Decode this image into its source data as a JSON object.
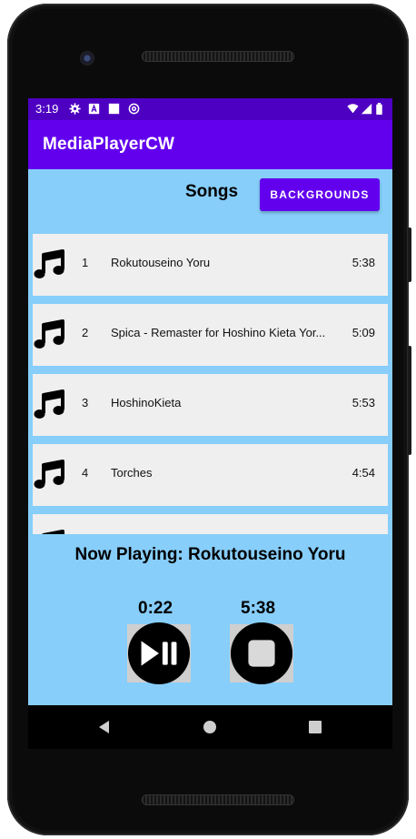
{
  "status_bar": {
    "time": "3:19",
    "icons": [
      "settings-gear-icon",
      "a-box-icon",
      "white-square-icon",
      "at-sign-icon",
      "wifi-icon",
      "signal-icon",
      "battery-icon"
    ]
  },
  "app_bar": {
    "title": "MediaPlayerCW"
  },
  "header": {
    "title": "Songs",
    "backgrounds_button": "BACKGROUNDS"
  },
  "songs": [
    {
      "num": "1",
      "title": "Rokutouseino Yoru",
      "duration": "5:38"
    },
    {
      "num": "2",
      "title": "Spica - Remaster for Hoshino Kieta Yor...",
      "duration": "5:09"
    },
    {
      "num": "3",
      "title": "HoshinoKieta",
      "duration": "5:53"
    },
    {
      "num": "4",
      "title": "Torches",
      "duration": "4:54"
    },
    {
      "num": "",
      "title": "",
      "duration": ""
    }
  ],
  "player": {
    "now_playing": "Now Playing: Rokutouseino Yoru",
    "elapsed": "0:22",
    "total": "5:38",
    "play_pause_icon": "play-pause-icon",
    "stop_icon": "stop-icon"
  },
  "nav_bar": {
    "icons": [
      "back-icon",
      "home-icon",
      "recents-icon"
    ]
  },
  "colors": {
    "status_bar": "#4e00c2",
    "app_bar": "#6200ee",
    "background": "#87cefa",
    "row": "#efefef"
  }
}
